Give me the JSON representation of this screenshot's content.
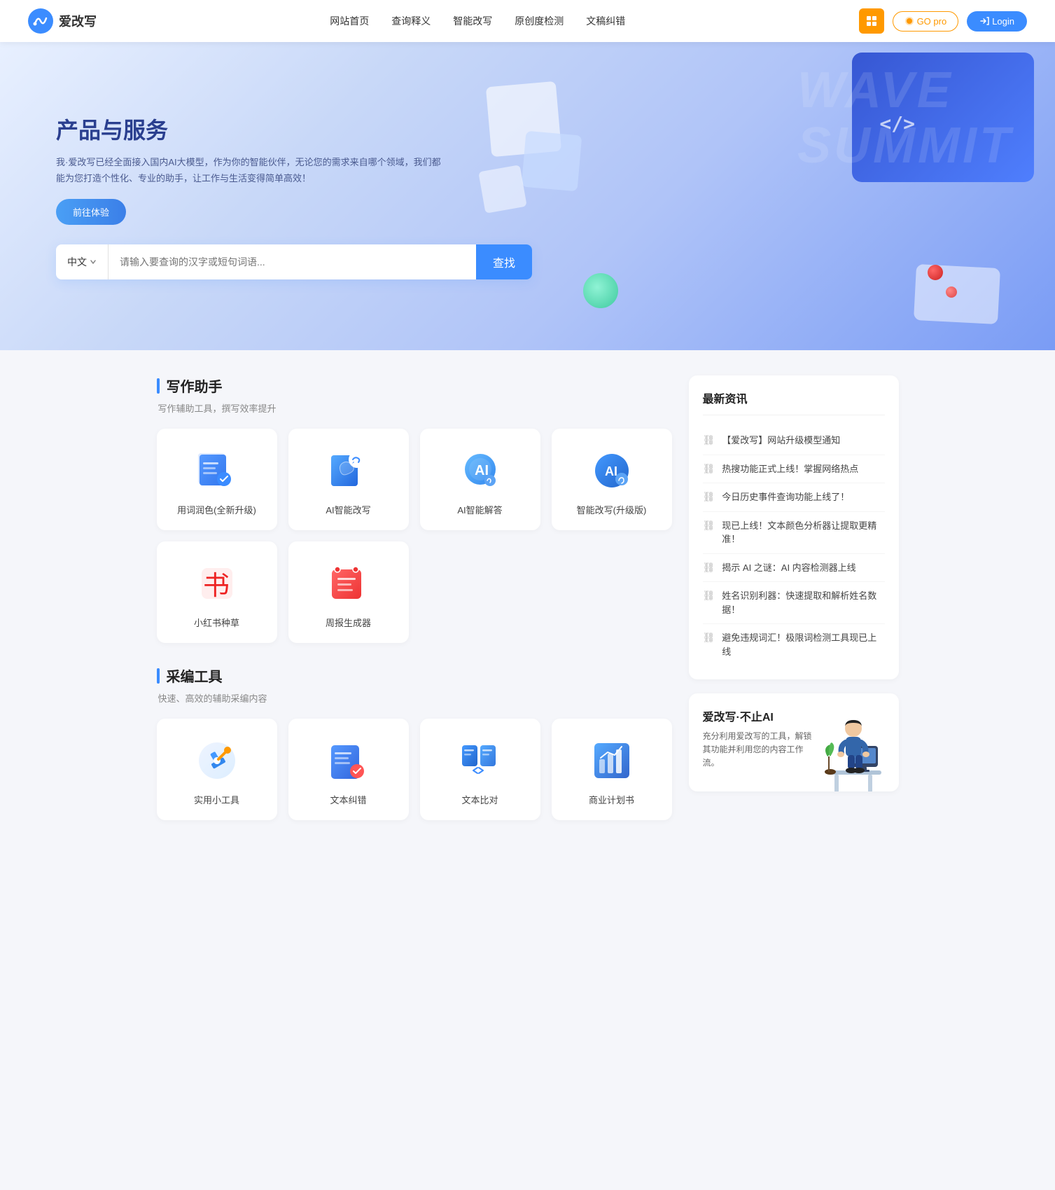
{
  "header": {
    "logo_text": "爱改写",
    "nav_items": [
      "网站首页",
      "查询释义",
      "智能改写",
      "原创度检测",
      "文稿纠错"
    ],
    "btn_grid_label": "⊞",
    "btn_go_pro_label": "GO pro",
    "btn_login_label": "Login"
  },
  "hero": {
    "title": "产品与服务",
    "desc": "我·爱改写已经全面接入国内AI大模型，作为你的智能伙伴，无论您的需求来自哪个领域，我们都能为您打造个性化、专业的助手，让工作与生活变得简单高效！",
    "btn_experience": "前往体验",
    "search_lang": "中文",
    "search_placeholder": "请输入要查询的汉字或短句词语...",
    "btn_search_label": "查找",
    "wave_text": "WAVE\nSUMMIT"
  },
  "writing_assistant": {
    "section_title": "写作助手",
    "section_subtitle": "写作辅助工具，撰写效率提升",
    "tools": [
      {
        "name": "用词润色(全新升级)",
        "icon_type": "words"
      },
      {
        "name": "AI智能改写",
        "icon_type": "ai-rewrite"
      },
      {
        "name": "AI智能解答",
        "icon_type": "ai-answer"
      },
      {
        "name": "智能改写(升级版)",
        "icon_type": "smart-rewrite"
      },
      {
        "name": "小红书种草",
        "icon_type": "xiaohongshu"
      },
      {
        "name": "周报生成器",
        "icon_type": "weekly"
      }
    ]
  },
  "cai_bian_tools": {
    "section_title": "采编工具",
    "section_subtitle": "快速、高效的辅助采编内容",
    "tools": [
      {
        "name": "实用小工具",
        "icon_type": "utils"
      },
      {
        "name": "文本纠错",
        "icon_type": "grammar"
      },
      {
        "name": "文本比对",
        "icon_type": "compare"
      },
      {
        "name": "商业计划书",
        "icon_type": "business"
      }
    ]
  },
  "news": {
    "title": "最新资讯",
    "items": [
      "【爱改写】网站升级模型通知",
      "热搜功能正式上线！掌握网络热点",
      "今日历史事件查询功能上线了！",
      "现已上线！文本颜色分析器让提取更精准！",
      "揭示 AI 之谜：AI 内容检测器上线",
      "姓名识别利器：快速提取和解析姓名数据！",
      "避免违规词汇！极限词检测工具现已上线"
    ]
  },
  "promo": {
    "title": "爱改写·不止AI",
    "desc": "充分利用爱改写的工具，解锁其功能并利用您的内容工作流。"
  }
}
